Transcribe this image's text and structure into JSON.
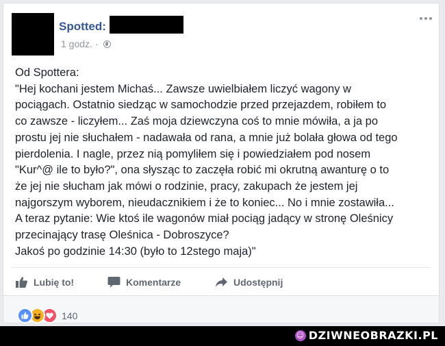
{
  "post": {
    "page_name": "Spotted:",
    "time": "1 godz.",
    "separator": "·",
    "lines": [
      "Od Spottera:",
      "\"Hej kochani jestem Michaś... Zawsze uwielbiałem liczyć wagony w",
      "pociągach. Ostatnio siedząc w samochodzie przed przejazdem, robiłem to",
      "co zawsze - liczyłem... Zaś moja dziewczyna coś to mnie mówiła, a ja po",
      "prostu jej nie słuchałem - nadawała od rana, a mnie już bolała głowa od tego",
      "pierdolenia. I nagle, przez nią pomyliłem się i powiedziałem pod nosem",
      "\"Kur^@ ile to było?\", ona słysząc to zaczęła robić mi okrutną awanturę o to",
      "że jej nie słucham jak mówi o rodzinie, pracy, zakupach że jestem jej",
      "najgorszym wyborem, nieudacznikiem i że to koniec... No i mnie zostawiła...",
      "A teraz pytanie: Wie ktoś ile wagonów miał pociąg jadący w stronę Oleśnicy",
      "przecinający trasę Oleśnica - Dobroszyce?",
      "Jakoś po godzinie 14:30 (było to 12stego maja)\""
    ]
  },
  "actions": {
    "like": "Lubię to!",
    "comment": "Komentarze",
    "share": "Udostępnij"
  },
  "reactions": {
    "icons": [
      "like-icon",
      "haha-icon",
      "love-icon"
    ],
    "count": "140"
  },
  "footer": {
    "brand": "DZIWNEOBRAZKI.PL"
  },
  "colors": {
    "link": "#365899",
    "text": "#1d2129",
    "muted": "#606770",
    "like": "#5890ff",
    "haha": "#f7b125",
    "love": "#f25268",
    "brand_accent": "#b04fc8"
  }
}
